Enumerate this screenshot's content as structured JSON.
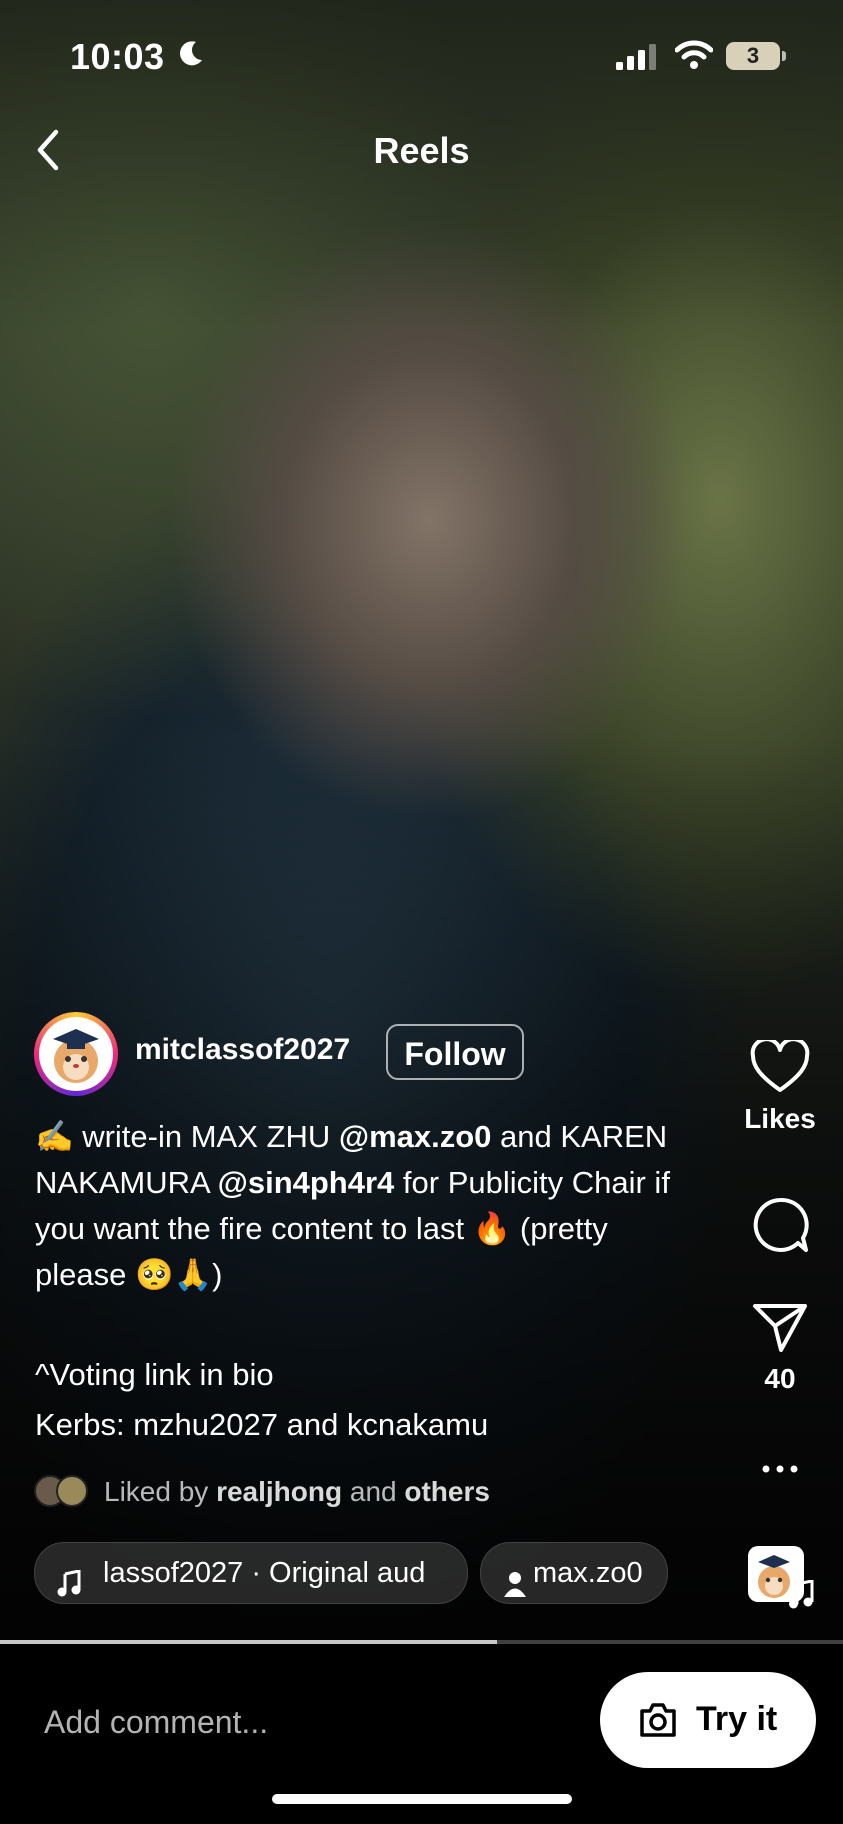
{
  "status_bar": {
    "time": "10:03",
    "battery": "3"
  },
  "header": {
    "title": "Reels"
  },
  "post": {
    "username": "mitclassof2027",
    "follow_label": "Follow",
    "caption": {
      "p1": "✍️ write-in MAX ZHU ",
      "mention1": "@max.zo0",
      "p2": " and KAREN NAKAMURA ",
      "mention2": "@sin4ph4r4",
      "p3": " for Publicity Chair if you want the fire content to last 🔥 (pretty please 🥺🙏)"
    },
    "caption_line2": "^Voting link in bio",
    "caption_line3": "Kerbs: mzhu2027 and kcnakamu",
    "liked_by": {
      "prefix": "Liked by ",
      "user": "realjhong",
      "middle": " and ",
      "others": "others"
    },
    "audio_label": "lassof2027 · Original aud",
    "tagged_user": "max.zo0"
  },
  "rail": {
    "likes_label": "Likes",
    "shares_count": "40"
  },
  "bottom": {
    "comment_placeholder": "Add comment...",
    "try_label": "Try it"
  },
  "progress_fraction": 0.59,
  "icons": [
    "back-chevron-icon",
    "moon-icon",
    "signal-icon",
    "wifi-icon",
    "battery-icon",
    "heart-icon",
    "comment-icon",
    "share-icon",
    "more-icon",
    "music-note-icon",
    "person-icon",
    "camera-icon"
  ]
}
